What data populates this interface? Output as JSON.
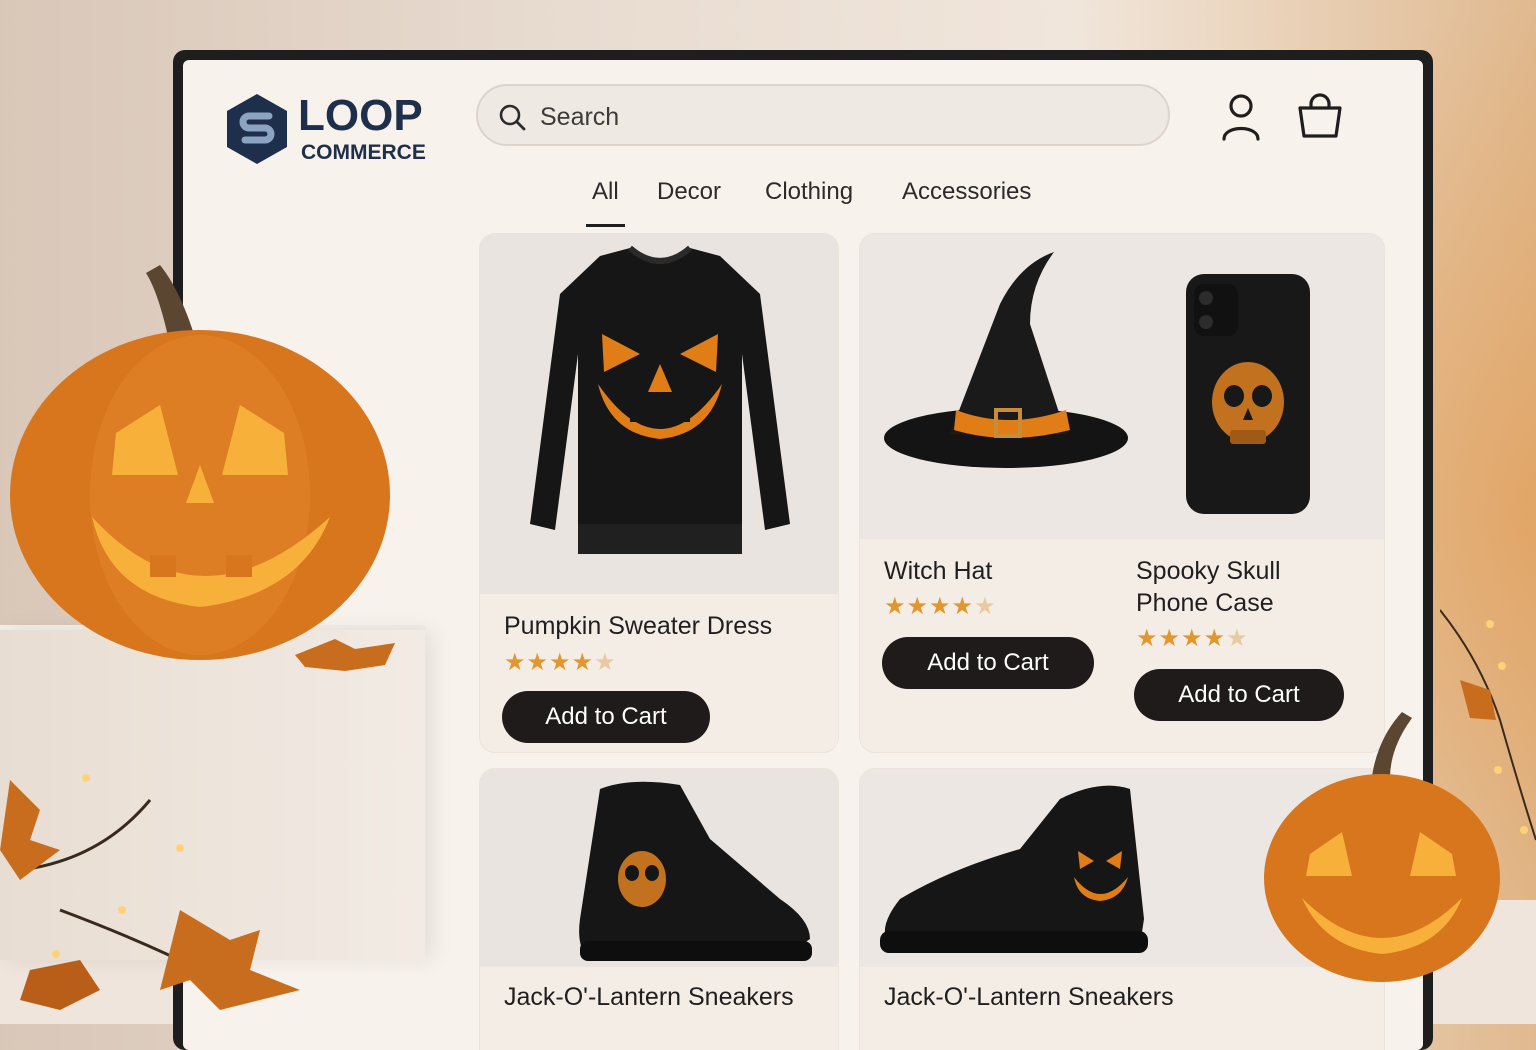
{
  "brand": {
    "name_line1": "LOOP",
    "name_line2": "COMMERCE"
  },
  "search": {
    "placeholder": "Search"
  },
  "header_icons": [
    "user-icon",
    "shopping-bag-icon"
  ],
  "tabs": [
    {
      "label": "All",
      "active": true
    },
    {
      "label": "Decor",
      "active": false
    },
    {
      "label": "Clothing",
      "active": false
    },
    {
      "label": "Accessories",
      "active": false
    }
  ],
  "products": [
    {
      "name": "Pumpkin Sweater Dress",
      "rating": 4.5,
      "button": "Add to Cart"
    },
    {
      "name": "Witch Hat",
      "rating": 4.5,
      "button": "Add to Cart"
    },
    {
      "name": "Spooky Skull Phone Case",
      "rating": 4.5,
      "button": "Add to Cart"
    },
    {
      "name": "Jack-O'-Lantern Sneakers"
    },
    {
      "name": "Jack-O'-Lantern Sneakers"
    }
  ],
  "stars": "★★★★",
  "half_star": "★",
  "colors": {
    "accent": "#e2962e",
    "button": "#1f1b1a",
    "brand": "#1d2f4a"
  }
}
